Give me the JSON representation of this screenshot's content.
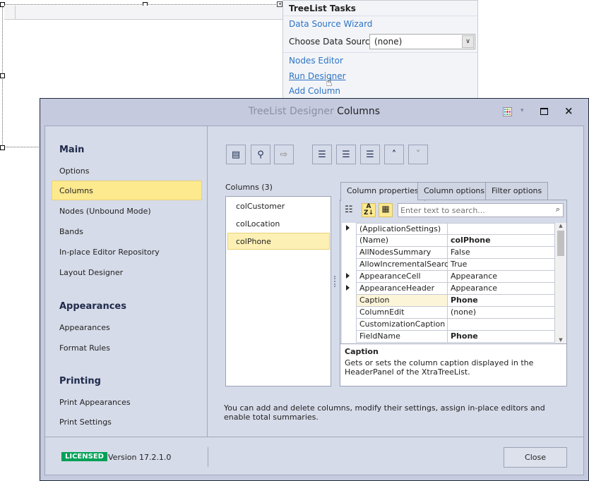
{
  "tasks": {
    "title": "TreeList Tasks",
    "data_source_wizard": "Data Source Wizard",
    "choose_label": "Choose Data Source",
    "choose_value": "(none)",
    "nodes_editor": "Nodes Editor",
    "run_designer": "Run Designer",
    "add_column": "Add Column"
  },
  "window": {
    "title_prefix": "TreeList Designer",
    "title_page": "Columns"
  },
  "nav": {
    "sections": [
      {
        "header": "Main",
        "items": [
          "Options",
          "Columns",
          "Nodes (Unbound Mode)",
          "Bands",
          "In-place Editor Repository",
          "Layout Designer"
        ]
      },
      {
        "header": "Appearances",
        "items": [
          "Appearances",
          "Format Rules"
        ]
      },
      {
        "header": "Printing",
        "items": [
          "Print Appearances",
          "Print Settings"
        ]
      }
    ],
    "active": "Columns"
  },
  "columns": {
    "label": "Columns (3)",
    "items": [
      "colCustomer",
      "colLocation",
      "colPhone"
    ],
    "selected": "colPhone"
  },
  "tabs": [
    "Column properties",
    "Column options",
    "Filter options"
  ],
  "search": {
    "placeholder": "Enter text to search..."
  },
  "properties": [
    {
      "name": "(ApplicationSettings)",
      "value": "",
      "expand": true
    },
    {
      "name": "(Name)",
      "value": "colPhone",
      "bold": true
    },
    {
      "name": "AllNodesSummary",
      "value": "False"
    },
    {
      "name": "AllowIncrementalSearch",
      "value": "True"
    },
    {
      "name": "AppearanceCell",
      "value": "Appearance",
      "expand": true
    },
    {
      "name": "AppearanceHeader",
      "value": "Appearance",
      "expand": true
    },
    {
      "name": "Caption",
      "value": "Phone",
      "bold": true,
      "selected": true
    },
    {
      "name": "ColumnEdit",
      "value": "(none)"
    },
    {
      "name": "CustomizationCaption",
      "value": ""
    },
    {
      "name": "FieldName",
      "value": "Phone",
      "bold": true
    }
  ],
  "description": {
    "title": "Caption",
    "text": "Gets or sets the column caption displayed in the HeaderPanel of the XtraTreeList."
  },
  "help": "You can add and delete columns, modify their settings, assign in-place editors and enable total summaries.",
  "footer": {
    "badge": "LICENSED",
    "version": "Version 17.2.1.0",
    "close": "Close"
  },
  "colors": {
    "accent": "#2b74c7",
    "selected": "#fde98e",
    "badge": "#00a057",
    "title_bar": "#c5cadf",
    "panel": "#d6dbe9"
  }
}
